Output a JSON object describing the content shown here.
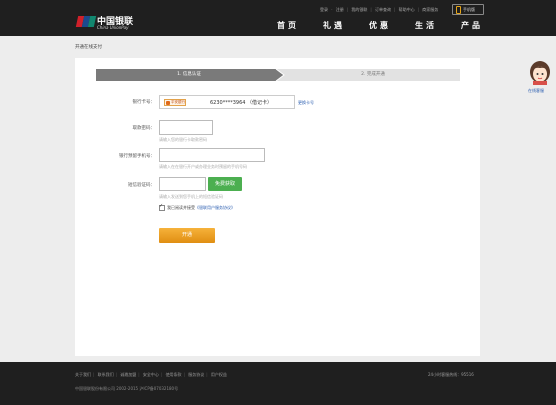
{
  "header": {
    "brand_cn": "中国银联",
    "brand_en": "China UnionPay",
    "top_links": [
      "登录",
      "注册",
      "我的银联",
      "订单查询",
      "帮助中心",
      "商家服务"
    ],
    "phone_label": "手机版",
    "nav": [
      "首页",
      "礼遇",
      "优惠",
      "生活",
      "产品"
    ]
  },
  "breadcrumb": "开通在线支付",
  "steps": {
    "step1": "1. 信息认证",
    "step2": "2. 完成开通",
    "current": 1
  },
  "form": {
    "card_label": "银行卡号：",
    "bank_name": "平安银行",
    "card_number": "6230****3964 （借记卡）",
    "change_card": "更换卡号",
    "pin_label": "取款密码：",
    "pin_hint": "请输入您的银行卡取款密码",
    "phone_label": "银行预留手机号：",
    "phone_hint": "请输入在在银行开户或办理业务时预留的手机号码",
    "sms_label": "短信验证码：",
    "sms_button": "免费获取",
    "sms_hint": "请输入发送到您手机上的短信验证码",
    "agree_text": "我已阅读并接受",
    "agree_link": "《银联用户服务协议》",
    "submit": "开通"
  },
  "service": {
    "label": "在线客服"
  },
  "footer": {
    "links": [
      "关于我们",
      "联系我们",
      "诚邀加盟",
      "安全中心",
      "使用条款",
      "服务协议",
      "用户权益"
    ],
    "hotline": "24小时客服热线：95516",
    "copyright": "中国银联股份有限公司 2002-2015 沪ICP备07032180号"
  },
  "colors": {
    "header_bg": "#1f1f1f",
    "step_active": "#777777",
    "submit": "#e89a1f",
    "sms_button": "#4caf50",
    "link": "#2a5db0"
  }
}
